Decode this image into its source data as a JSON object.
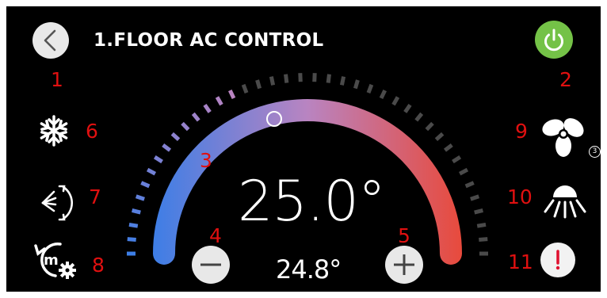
{
  "header": {
    "title": "1.FLOOR AC CONTROL"
  },
  "thermostat": {
    "set_temperature": "25.0°",
    "current_temperature": "24.8°"
  },
  "fan": {
    "speed": "3"
  },
  "annotations": [
    "1",
    "2",
    "3",
    "4",
    "5",
    "6",
    "7",
    "8",
    "9",
    "10",
    "11"
  ],
  "colors": {
    "background": "#000000",
    "power": "#74c247",
    "alert": "#e0102e",
    "arc_cool": "#3d7ee6",
    "arc_warm": "#e84a3c",
    "annotation": "#e01010"
  },
  "icons": {
    "back": "chevron-left-icon",
    "power": "power-icon",
    "mode": "snowflake-icon",
    "swing": "louver-swing-icon",
    "schedule": "mode-schedule-gear-icon",
    "fan": "fan-icon",
    "vane": "airflow-vane-icon",
    "alert": "exclamation-icon",
    "minus": "minus-icon",
    "plus": "plus-icon"
  }
}
